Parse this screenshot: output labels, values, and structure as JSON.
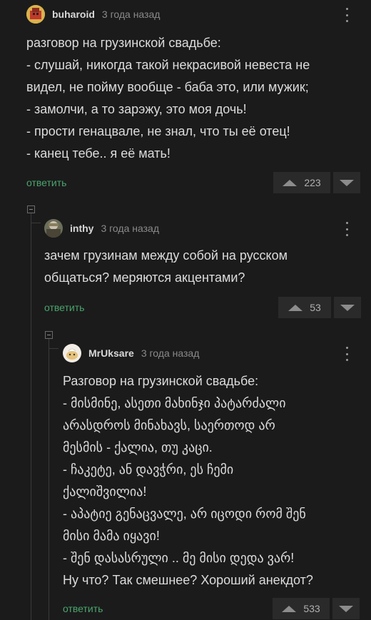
{
  "comments": [
    {
      "username": "buharoid",
      "time": "3 года назад",
      "lines": [
        "разговор на грузинской свадьбе:",
        "- слушай, никогда такой некрасивой невеста не",
        "видел, не пойму вообще - баба это, или мужик;",
        "- замолчи, а то зарэжу, это моя дочь!",
        "- прости генацвале, не знал, что ты её отец!",
        "- канец тебе.. я её мать!"
      ],
      "reply_label": "ответить",
      "score": "223"
    },
    {
      "username": "inthy",
      "time": "3 года назад",
      "lines": [
        "зачем грузинам между собой на русском",
        "общаться? меряются акцентами?"
      ],
      "reply_label": "ответить",
      "score": "53"
    },
    {
      "username": "MrUksare",
      "time": "3 года назад",
      "lines": [
        "Разговор на грузинской свадьбе:",
        "- მისმინე, ასეთი მახინჯი პატარძალი",
        "არასდროს მინახავს, საერთოდ არ",
        "მესმის - ქალია, თუ კაცი.",
        "- ჩაკეტე, ან დავჭრი, ეს ჩემი",
        "ქალიშვილია!",
        "- აპატიე გენაცვალე, არ იცოდი რომ შენ",
        "მისი მამა იყავი!",
        "- შენ დასასრული .. მე მისი დედა ვარ!",
        "Ну что? Так смешнее? Хороший анекдот?"
      ],
      "reply_label": "ответить",
      "score": "533"
    }
  ],
  "colors": {
    "background": "#1b1b1c",
    "reply_link": "#4aa56b",
    "username": "#d8d8d8",
    "timestamp": "#8a8a8a"
  }
}
